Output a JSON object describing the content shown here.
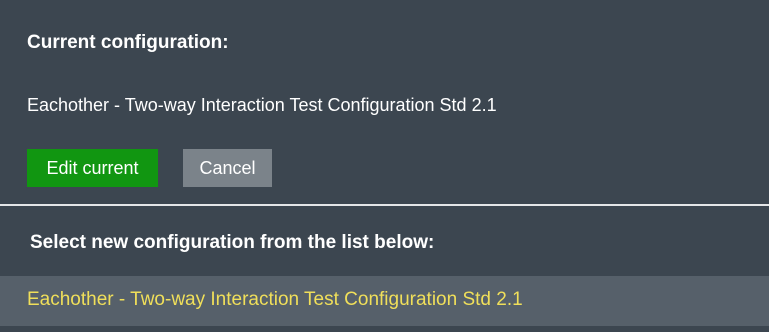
{
  "current": {
    "heading": "Current configuration:",
    "name": "Eachother - Two-way Interaction Test Configuration Std 2.1",
    "edit_label": "Edit current",
    "cancel_label": "Cancel"
  },
  "select": {
    "heading": "Select new configuration from the list below:",
    "items": [
      {
        "label": "Eachother - Two-way Interaction Test Configuration Std 2.1"
      }
    ]
  },
  "colors": {
    "panel_bg": "#3c4650",
    "edit_button": "#119611",
    "cancel_button": "#7b838a",
    "list_item_bg": "#56606a",
    "list_item_text": "#f0df5a"
  }
}
